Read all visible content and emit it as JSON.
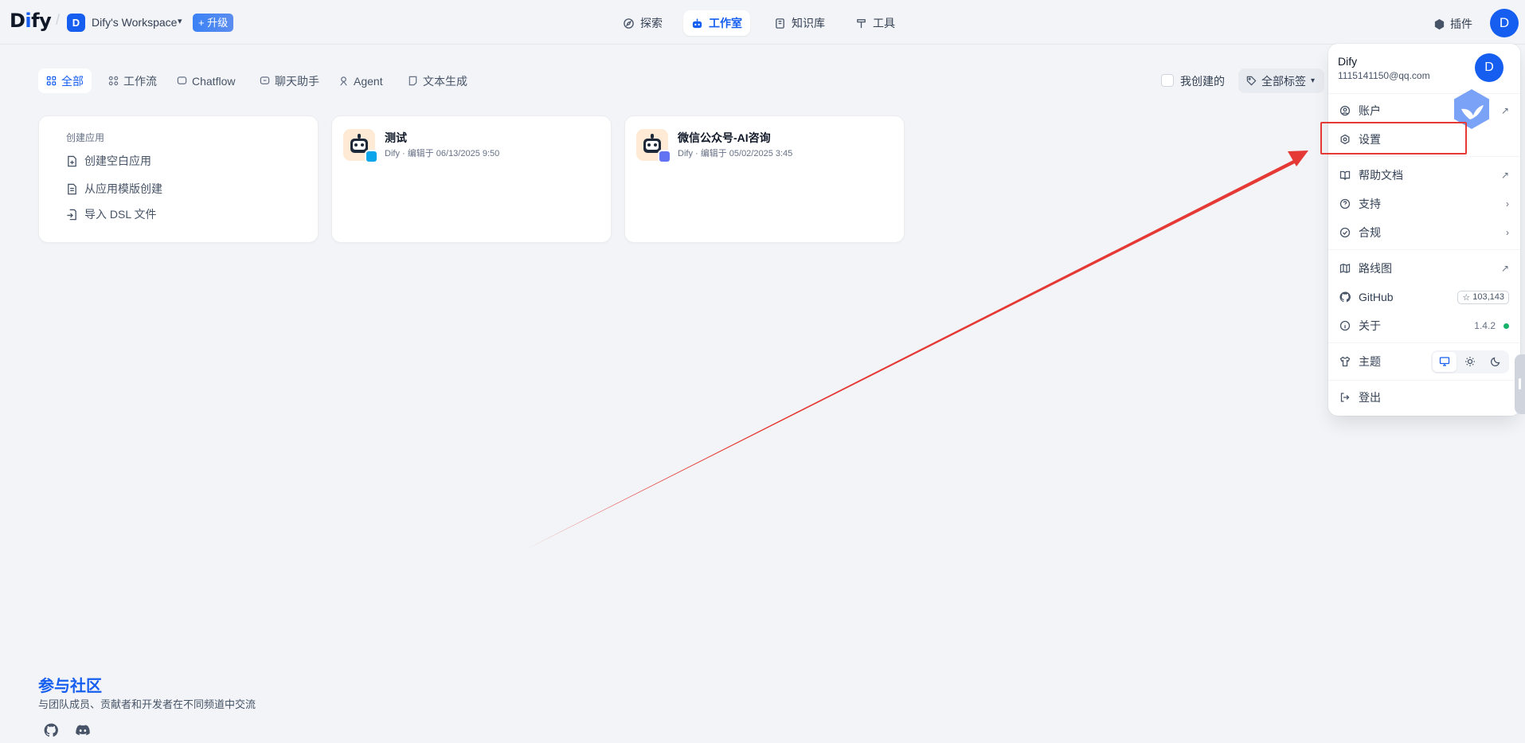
{
  "header": {
    "logo_text": "Dify",
    "workspace_initial": "D",
    "workspace_name": "Dify's Workspace",
    "upgrade_label": "+ 升级",
    "nav": [
      {
        "label": "探索",
        "icon": "compass-icon"
      },
      {
        "label": "工作室",
        "icon": "robot-icon",
        "active": true
      },
      {
        "label": "知识库",
        "icon": "book-icon"
      },
      {
        "label": "工具",
        "icon": "hammer-icon"
      }
    ],
    "plugins_label": "插件",
    "user_initial": "D"
  },
  "filters": {
    "tabs": [
      {
        "label": "全部",
        "active": true
      },
      {
        "label": "工作流"
      },
      {
        "label": "Chatflow"
      },
      {
        "label": "聊天助手"
      },
      {
        "label": "Agent"
      },
      {
        "label": "文本生成"
      }
    ],
    "mine_label": "我创建的",
    "mine_checked": false,
    "tags_label": "全部标签"
  },
  "create_card": {
    "title": "创建应用",
    "items": [
      "创建空白应用",
      "从应用模版创建",
      "导入 DSL 文件"
    ]
  },
  "apps": [
    {
      "name": "测试",
      "meta": "Dify · 编辑于 06/13/2025 9:50",
      "badge_color": "#0ba5ec"
    },
    {
      "name": "微信公众号-AI咨询",
      "meta": "Dify · 编辑于 05/02/2025 3:45",
      "badge_color": "#6172f3"
    }
  ],
  "community": {
    "title": "参与社区",
    "subtitle": "与团队成员、贡献者和开发者在不同频道中交流",
    "links": [
      "github-icon",
      "discord-icon"
    ]
  },
  "menu": {
    "name": "Dify",
    "email": "1115141150@qq.com",
    "avatar_initial": "D",
    "items": {
      "account": "账户",
      "settings": "设置",
      "help_docs": "帮助文档",
      "support": "支持",
      "compliance": "合规",
      "roadmap": "路线图",
      "github": "GitHub",
      "github_stars": "103,143",
      "about": "关于",
      "version": "1.4.2",
      "theme": "主题",
      "theme_selected": "system",
      "logout": "登出"
    }
  },
  "colors": {
    "accent": "#155eef",
    "background": "#f2f4f7",
    "annotation_red": "#e53935",
    "status_green": "#17b26a"
  }
}
